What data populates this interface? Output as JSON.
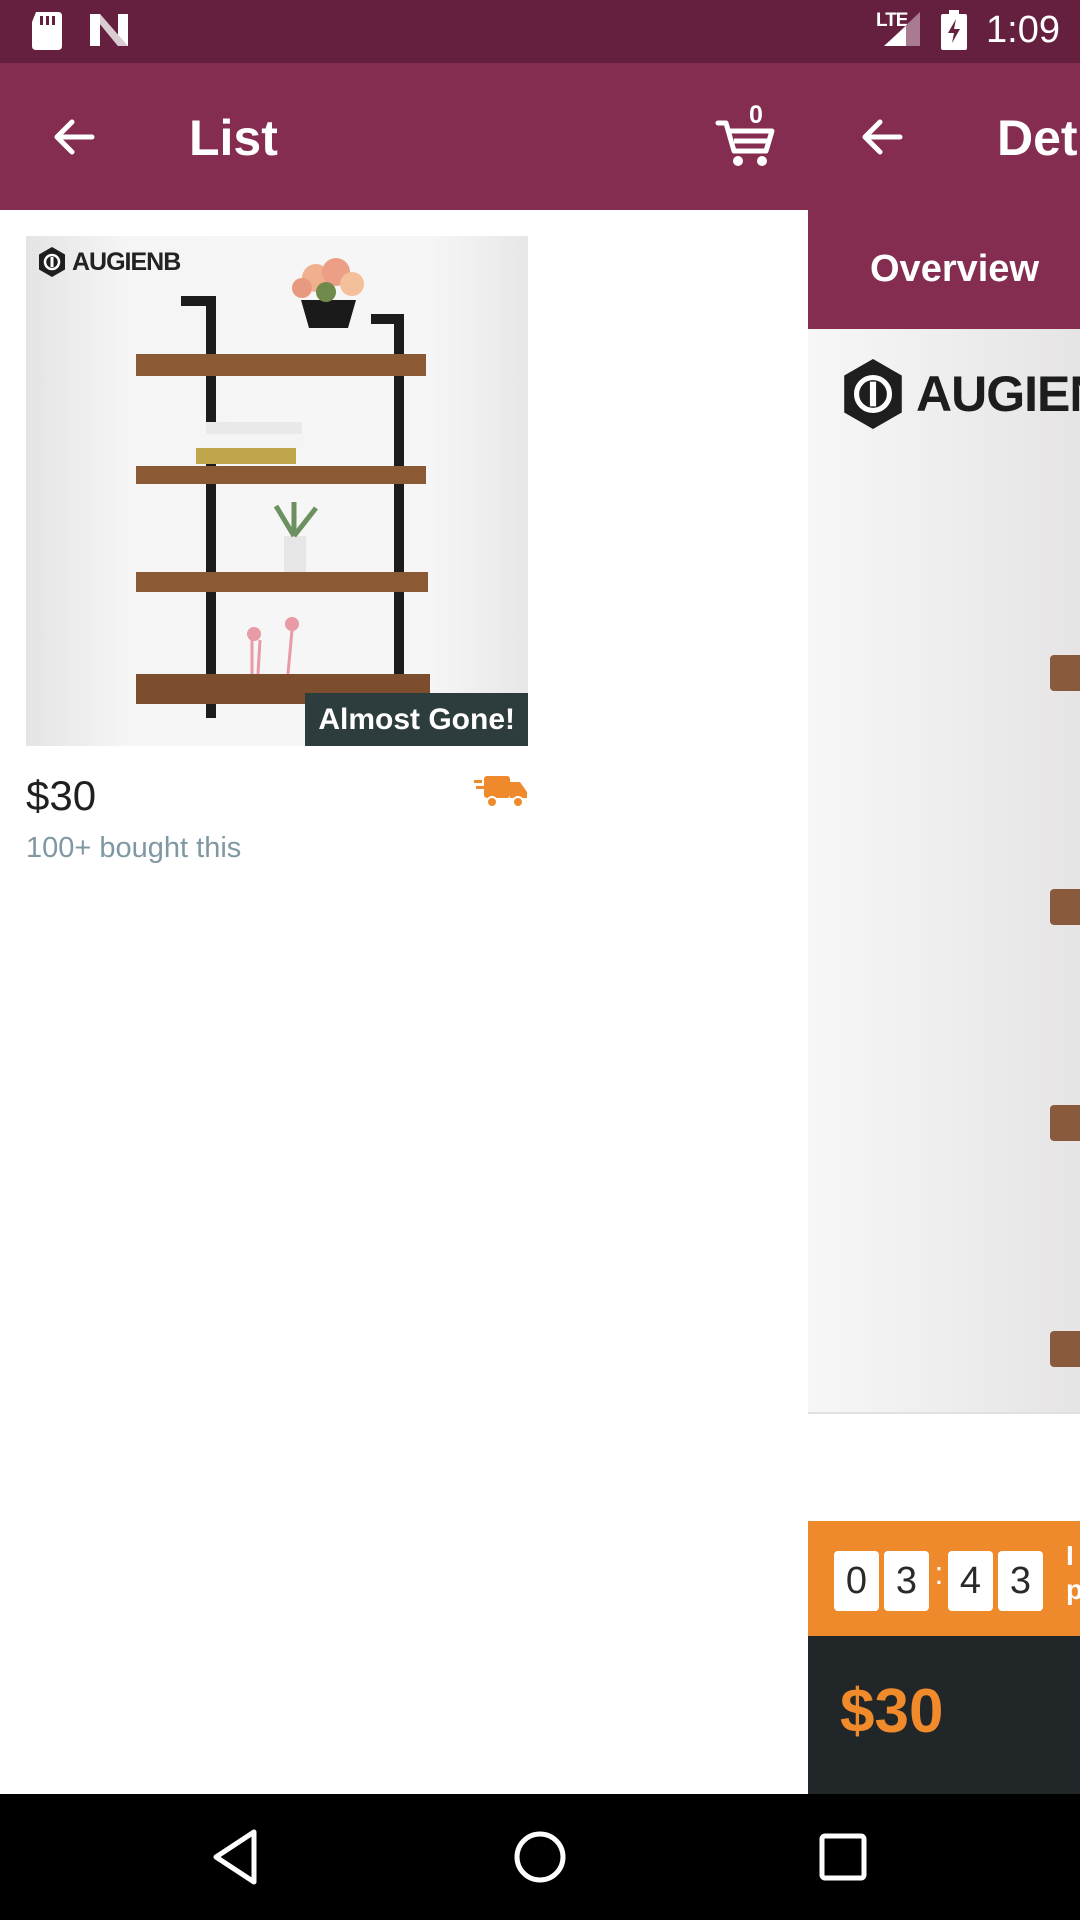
{
  "status_bar": {
    "network": "LTE",
    "time": "1:09",
    "icons": [
      "sd-card-icon",
      "n-notification-icon",
      "signal-icon",
      "battery-charging-icon"
    ]
  },
  "list_screen": {
    "title": "List",
    "cart_count": "0",
    "product": {
      "brand": "AUGIENB",
      "badge": "Almost Gone!",
      "price": "$30",
      "bought": "100+ bought this"
    }
  },
  "detail_screen": {
    "title": "Det",
    "tab": "Overview",
    "brand": "AUGIEN",
    "countdown": [
      "0",
      "3",
      "4",
      "3"
    ],
    "countdown_separator": ":",
    "promo_line1": "I",
    "promo_line2": "p",
    "price": "$30"
  },
  "colors": {
    "status_bar": "#65203f",
    "app_bar": "#842d51",
    "accent_orange": "#ef8a2c",
    "badge_bg": "#2d3c3c",
    "price_bar": "#212628"
  }
}
